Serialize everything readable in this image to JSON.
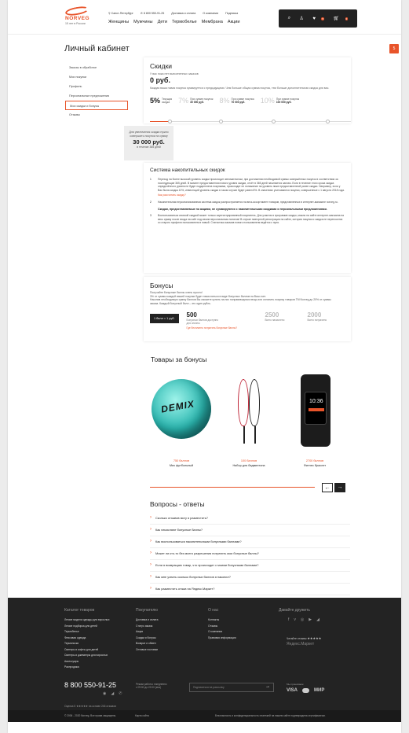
{
  "header": {
    "logo_text": "NORVEG",
    "logo_tagline": "15 лет в России",
    "city": "Санкт-Петербург",
    "phone": "8 800 550-91-25",
    "top_links": [
      "Доставка и оплата",
      "О компании",
      "Подписка"
    ],
    "nav": [
      "Женщины",
      "Мужчины",
      "Дети",
      "Термобелье",
      "Мембрана",
      "Акции"
    ],
    "fav_count": "5",
    "cart_count": "0"
  },
  "side_badge": "5",
  "page_title": "Личный кабинет",
  "left_menu": [
    "Заказы в обработке",
    "Мои покупки",
    "Профиль",
    "Персональные предложения",
    "Мои скидки и бонусы",
    "Отзывы"
  ],
  "discounts": {
    "title": "Скидки",
    "sum_label": "У вас пока нет выполненных заказов",
    "sum_value": "0 руб.",
    "note": "Каждая ваша новая покупка суммируется с предыдущими. Чем больше общая сумма покупок, тем больше дополнительная скидка для вас.",
    "tiers": [
      {
        "pct": "5%",
        "l1": "Текущая",
        "l2": "скидка"
      },
      {
        "pct": "7%",
        "l1": "При сумме покупок",
        "l2": "30 000 руб."
      },
      {
        "pct": "8%",
        "l1": "При сумме покупок",
        "l2": "70 000 руб."
      },
      {
        "pct": "10%",
        "l1": "При сумме покупок",
        "l2": "100 000 руб."
      }
    ],
    "next_l1": "Для увеличения скидки нужно",
    "next_l2": "совершить покупок на сумму",
    "next_value": "30 000 руб.",
    "next_period": "в течение 365 дней"
  },
  "system": {
    "title": "Система накопительных скидок",
    "items": [
      {
        "n": "1",
        "text": "Переход на более высокий уровень скидки происходит автоматически, при достижении необходимой суммы совершённых покупок в соответствии за последующие 365 дней. В момент предоставления нового уровня скидки, отчёт в 365 дней начинается заново. Если в течение этого срока скидка определённого уровня не будет подкреплена покупками, происходит ее понижение на уровень ниже предоставленной ранее скидки. Например, если у Вас была скидка 10%, инвестиций уровень скидки в таком случае будет равен 8%. В значениях учитываются покупки, совершенные с 1 августа 2018 года.",
        "link": "Как рассчитать скидку?"
      },
      {
        "n": "2",
        "text": "Накопительная персонализованная система скидок распространяется на весь ассортимент товаров, представленных в интернет-магазине norveg.ru.",
        "bold": "Скидки, предоставляемые по акциям, не суммируются с накопительными скидками и персональными предложениями."
      },
      {
        "n": "3",
        "text": "Воспользоваться кнопкой скидкой может только зарегистрированный покупатель. Для участия в программе скидок, можно на сайте интернет-магазина на весь сумму после входа на сайт под своим персональным логином! В случае повторной регистрации на сайте, история покупок и скидка не переносится со старого профиля пользователя в новый. Статистика заказов нового пользователя ведётся с нуля."
      }
    ]
  },
  "bonuses": {
    "title": "Бонусы",
    "p1": "Получайте бонусные баллы очень просто!",
    "p2": "3% от суммы каждой вашей покупки будет начисляться в виде бонусных баллов на Ваш счет.",
    "p3": "Накопив необходимую сумму баллов Вы сможете купить на них понравившуюся вещь или оплатить покупку товаров ТМ Norveg до 20% от суммы заказа. Каждый бонусный балл – это один рубль.",
    "rate": "1 балл = 1 руб.",
    "stats": [
      {
        "v": "500",
        "d": "Бонусных баллов доступно для оплаты"
      },
      {
        "v": "2500",
        "d": "Всего начислено"
      },
      {
        "v": "2000",
        "d": "Всего потрачено"
      }
    ],
    "link": "Где бесплатно потратить бонусные баллы?"
  },
  "products": {
    "title": "Товары за бонусы",
    "items": [
      {
        "price": "750 баллов",
        "name": "Мяч футбольный",
        "img_text": "DEMIX"
      },
      {
        "price": "100 баллов",
        "name": "Набор для бадминтона"
      },
      {
        "price": "2700 баллов",
        "name": "Фитнес браслет",
        "img_text": "10:36"
      }
    ],
    "progress": 1.0
  },
  "faq": {
    "title": "Вопросы - ответы",
    "items": [
      "Сколько отзывов могу я разместить?",
      "Как начисляют бонусные баллы?",
      "Как воспользоваться накопительными бонусными баллами?",
      "Может ли кто-то без моего разрешения потратить мои бонусные баллы?",
      "Если я возвращаю товар, что происходит с моими бонусными баллами?",
      "Как мне узнать сколько бонусных баллов я накопил?",
      "Как разместить отзыв на Яндекс.Маркет?"
    ]
  },
  "footer": {
    "col1_h": "Каталог товаров",
    "col1": [
      "Легкие модели одежды для взрослых",
      "Легкие подборка для детей",
      "Термобелье",
      "Флисовая одежда",
      "Термоноски",
      "Свитеры и кофты для детей",
      "Свитеры и джемперы для взрослых",
      "Аксессуары",
      "Распродажа"
    ],
    "col2_h": "Покупателю",
    "col2": [
      "Доставка и оплата",
      "Статус заказа",
      "Акции",
      "Скидки и бонусы",
      "Возврат и обмен",
      "Оптовые поставки"
    ],
    "col3_h": "О нас",
    "col3": [
      "Контакты",
      "Отзывы",
      "О компании",
      "Правовая информация"
    ],
    "col4_h": "Давайте дружить",
    "social": [
      "f",
      "v",
      "◎",
      "▶",
      "◢"
    ],
    "ym_label": "Читайте отзывы",
    "ym_stars": "★★★★★",
    "ym_brand": "Яндекс.Маркет",
    "phone": "8 800 550-91-25",
    "work_l1": "Режим работы: ежедневно",
    "work_l2": "с 09:00 до 22:00 (мск)",
    "subscribe_ph": "Подписаться на рассылку",
    "pay_label": "Мы принимаем:",
    "pay": [
      "VISA",
      "МИР"
    ],
    "rating": "Оценка 5 ★★★★★ на основе 246 отзывов",
    "copy": "© 2006 - 2020 Norveg. Все права защищены.",
    "sitemap": "Карта сайта",
    "legal": "Безопасность и конфиденциальность платежей на нашем сайте подтверждена сертификатом."
  }
}
